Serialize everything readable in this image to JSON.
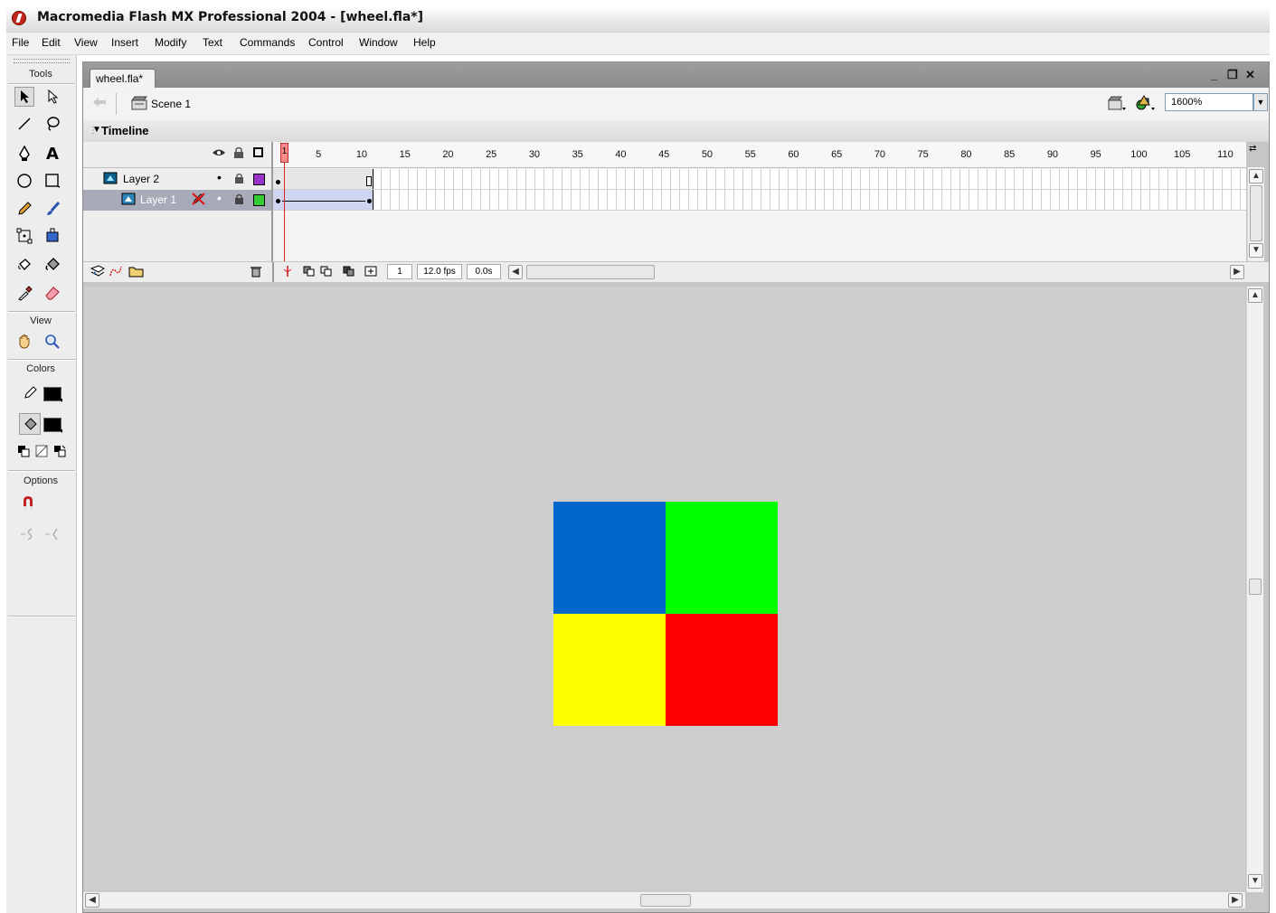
{
  "window": {
    "title": "Macromedia Flash MX Professional 2004 - [wheel.fla*]"
  },
  "menu": [
    "File",
    "Edit",
    "View",
    "Insert",
    "Modify",
    "Text",
    "Commands",
    "Control",
    "Window",
    "Help"
  ],
  "tools_panel": {
    "title": "Tools",
    "view_label": "View",
    "colors_label": "Colors",
    "options_label": "Options",
    "stroke_color": "#000000",
    "fill_color": "#000000"
  },
  "document": {
    "tab_label": "wheel.fla*",
    "scene_label": "Scene 1",
    "zoom": "1600%"
  },
  "timeline": {
    "title": "Timeline",
    "frame_numbers": [
      "1",
      "5",
      "10",
      "15",
      "20",
      "25",
      "30",
      "35",
      "40",
      "45",
      "50",
      "55",
      "60",
      "65",
      "70",
      "75",
      "80",
      "85",
      "90",
      "95",
      "100",
      "105",
      "110"
    ],
    "layers": [
      {
        "name": "Layer 2",
        "color": "#9933cc",
        "selected": false
      },
      {
        "name": "Layer 1",
        "color": "#33cc33",
        "selected": true
      }
    ],
    "current_frame": "1",
    "frame_rate": "12.0 fps",
    "elapsed_time": "0.0s"
  },
  "stage": {
    "quadrants": [
      {
        "name": "blue-quadrant",
        "color": "#0066cc"
      },
      {
        "name": "green-quadrant",
        "color": "#00ff00"
      },
      {
        "name": "yellow-quadrant",
        "color": "#ffff00"
      },
      {
        "name": "red-quadrant",
        "color": "#ff0000"
      }
    ]
  }
}
